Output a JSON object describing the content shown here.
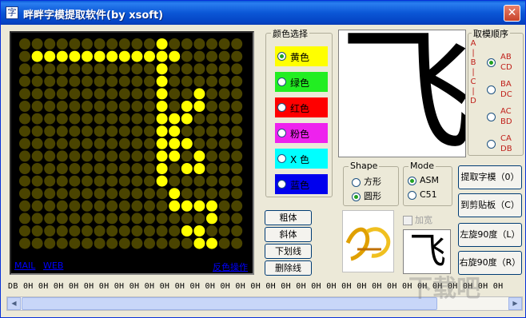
{
  "window": {
    "title": "畔畔字模提取软件(by xsoft)",
    "close_glyph": "✕",
    "icon_glyph": "字"
  },
  "colors": {
    "active_led": "#ffff00",
    "inactive_led": "#4a4400",
    "matrix_bg": "#000000"
  },
  "matrix": {
    "rows": 16,
    "cols": 16,
    "on": [
      [
        1,
        1
      ],
      [
        2,
        1
      ],
      [
        3,
        1
      ],
      [
        4,
        1
      ],
      [
        5,
        1
      ],
      [
        6,
        1
      ],
      [
        7,
        1
      ],
      [
        8,
        1
      ],
      [
        9,
        1
      ],
      [
        10,
        1
      ],
      [
        11,
        1
      ],
      [
        11,
        0
      ],
      [
        12,
        1
      ],
      [
        11,
        2
      ],
      [
        11,
        3
      ],
      [
        11,
        4
      ],
      [
        11,
        5
      ],
      [
        11,
        6
      ],
      [
        11,
        7
      ],
      [
        11,
        8
      ],
      [
        11,
        9
      ],
      [
        11,
        10
      ],
      [
        11,
        11
      ],
      [
        14,
        4
      ],
      [
        13,
        5
      ],
      [
        14,
        5
      ],
      [
        12,
        6
      ],
      [
        13,
        6
      ],
      [
        12,
        7
      ],
      [
        12,
        8
      ],
      [
        13,
        8
      ],
      [
        12,
        9
      ],
      [
        14,
        9
      ],
      [
        13,
        10
      ],
      [
        14,
        10
      ],
      [
        12,
        12
      ],
      [
        12,
        13
      ],
      [
        13,
        13
      ],
      [
        14,
        13
      ],
      [
        15,
        13
      ],
      [
        15,
        14
      ],
      [
        14,
        15
      ],
      [
        13,
        15
      ],
      [
        14,
        16
      ],
      [
        15,
        16
      ]
    ]
  },
  "links": {
    "mail": "MAIL",
    "web": "WEB",
    "invert": "反色操作"
  },
  "color_group": {
    "legend": "颜色选择",
    "options": [
      {
        "label": "黄色",
        "swatch": "#ffff00",
        "selected": true
      },
      {
        "label": "绿色",
        "swatch": "#22ee22",
        "selected": false
      },
      {
        "label": "红色",
        "swatch": "#ff0000",
        "selected": false
      },
      {
        "label": "粉色",
        "swatch": "#ee22ee",
        "selected": false
      },
      {
        "label": "X 色",
        "swatch": "#00ffff",
        "selected": false
      },
      {
        "label": "蓝色",
        "swatch": "#0000ee",
        "selected": false
      }
    ]
  },
  "preview": {
    "char": "飞"
  },
  "order_group": {
    "legend": "取模顺序",
    "vertical": [
      "A",
      "|",
      "B",
      "|",
      "C",
      "|",
      "D"
    ],
    "options": [
      {
        "line1": "AB",
        "line2": "CD",
        "selected": true
      },
      {
        "line1": "BA",
        "line2": "DC",
        "selected": false
      },
      {
        "line1": "AC",
        "line2": "BD",
        "selected": false
      },
      {
        "line1": "CA",
        "line2": "DB",
        "selected": false
      }
    ]
  },
  "shape_group": {
    "legend": "Shape",
    "options": [
      {
        "label": "方形",
        "selected": false
      },
      {
        "label": "圆形",
        "selected": true
      }
    ]
  },
  "mode_group": {
    "legend": "Mode",
    "options": [
      {
        "label": "ASM",
        "selected": true
      },
      {
        "label": "C51",
        "selected": false
      }
    ]
  },
  "style_buttons": [
    "粗体",
    "斜体",
    "下划线",
    "删除线"
  ],
  "bold_check": "加宽",
  "action_buttons": [
    "提取字模（0）",
    "到剪贴板（C）",
    "左旋90度（L）",
    "右旋90度（R）"
  ],
  "hex_output": "DB 0H 0H 0H 0H 0H 0H 0H 0H 0H 0H 0H 0H 0H 0H 0H 0H 0H 0H 0H 0H 0H 0H 0H 0H 0H 0H 0H 0H 0H 0H 0H 0H",
  "watermark": "下载吧"
}
